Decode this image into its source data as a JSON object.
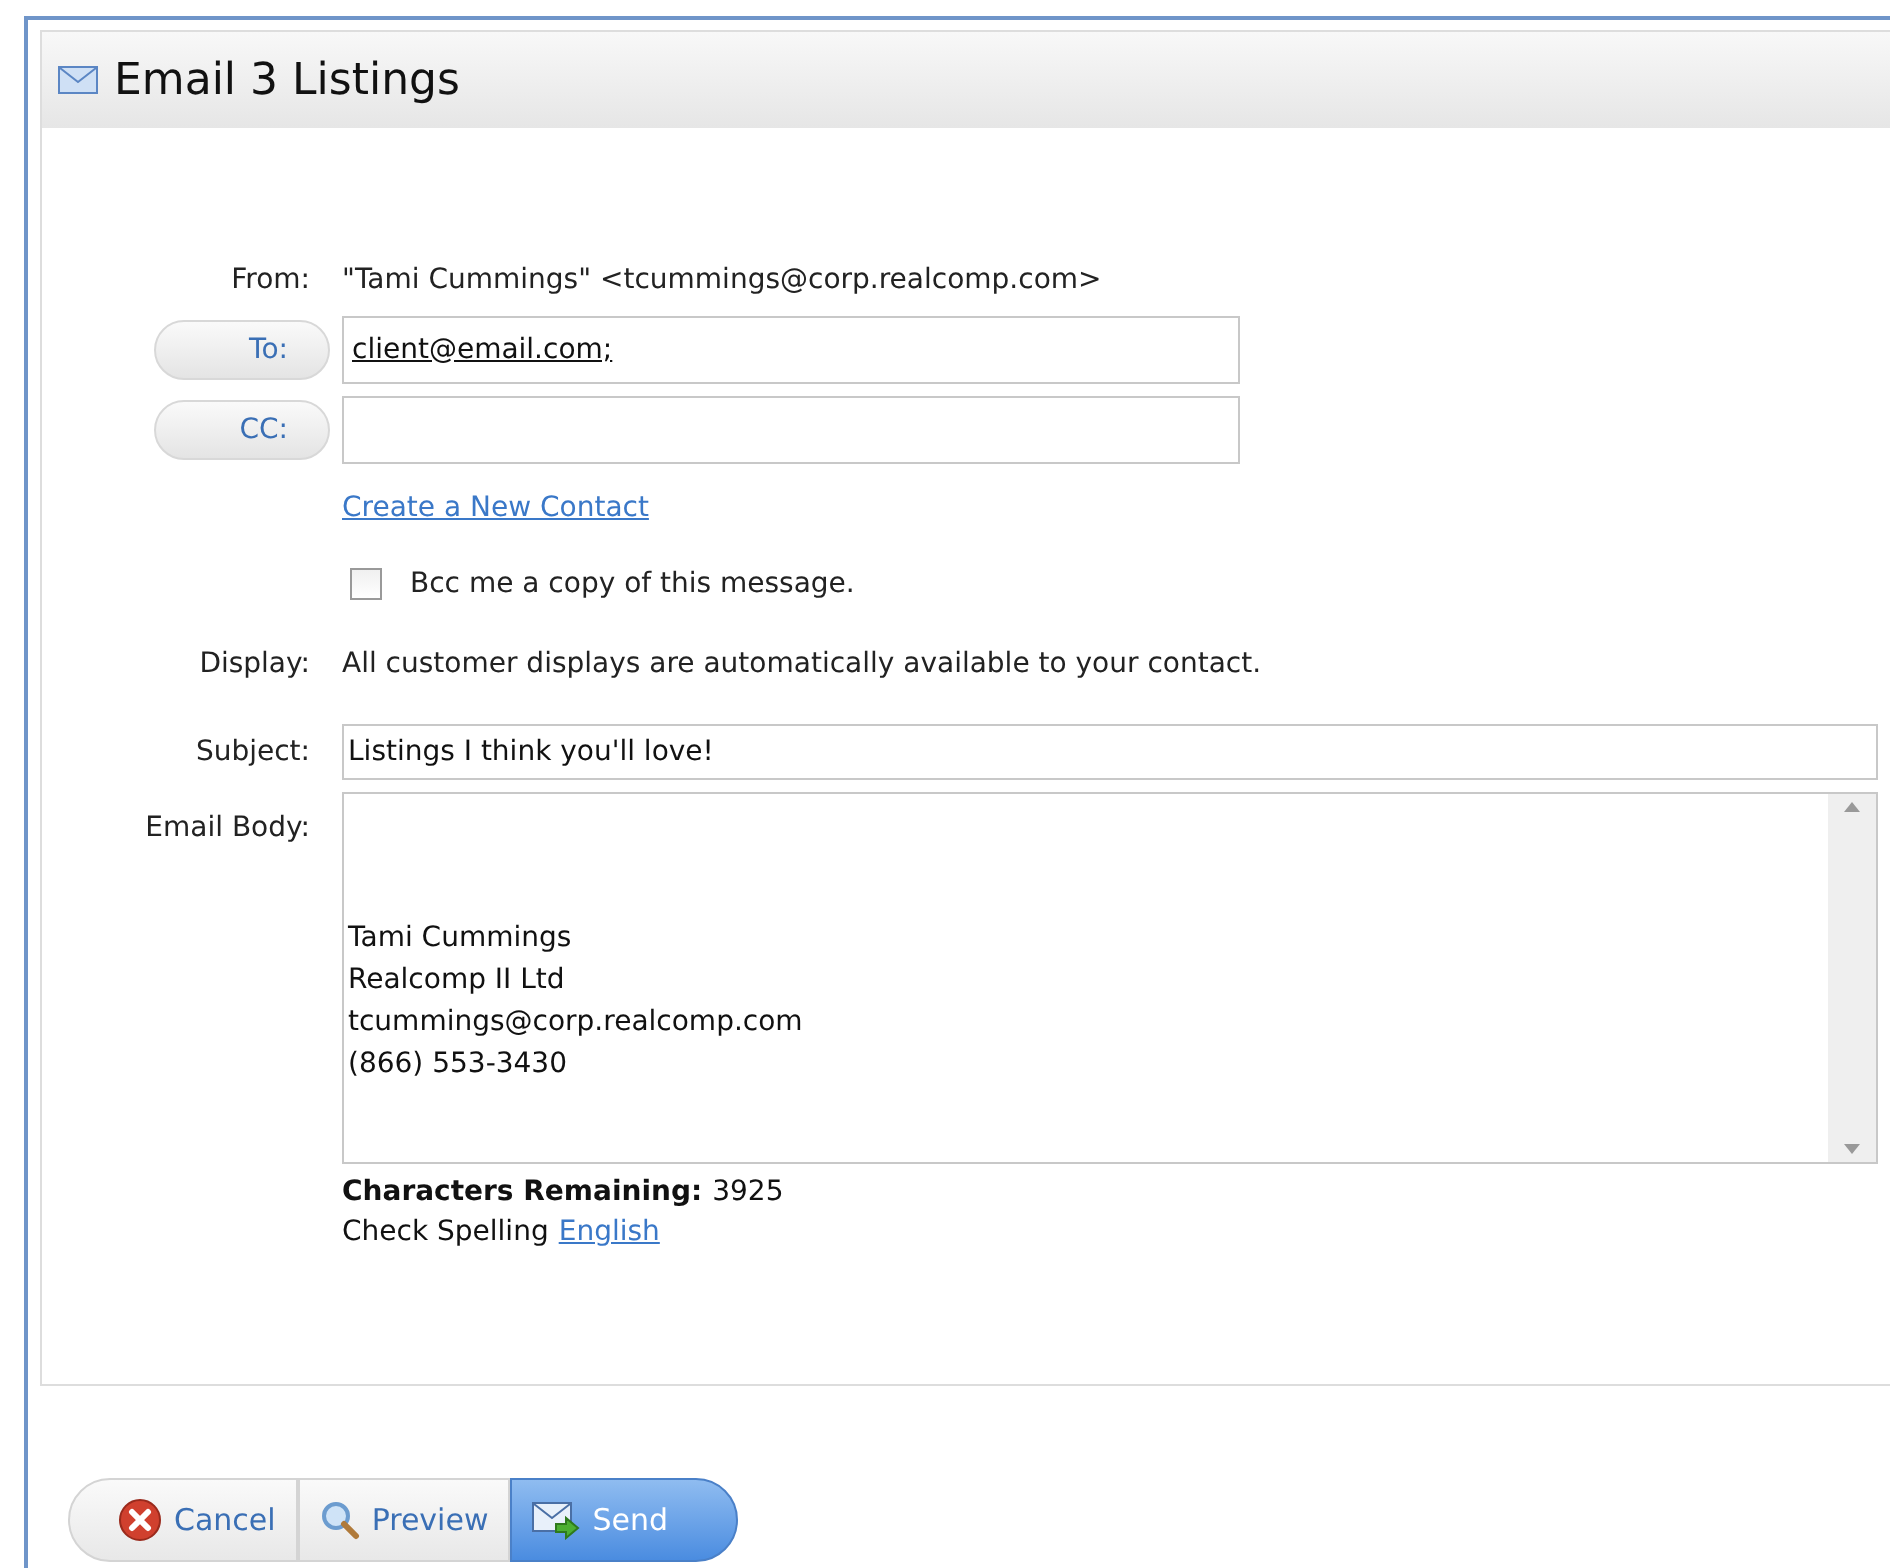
{
  "window": {
    "title": "Email 3 Listings"
  },
  "from": {
    "label": "From:",
    "value": "\"Tami Cummings\" <tcummings@corp.realcomp.com>"
  },
  "to": {
    "label": "To:",
    "value": "client@email.com;"
  },
  "cc": {
    "label": "CC:"
  },
  "create_contact_link": "Create a New Contact",
  "bcc": {
    "label": "Bcc me a copy of this message.",
    "checked": false
  },
  "display": {
    "label": "Display:",
    "value": "All customer displays are automatically available to your contact."
  },
  "subject": {
    "label": "Subject:",
    "value": "Listings I think you'll love!"
  },
  "body": {
    "label": "Email Body:",
    "lines": [
      "Tami Cummings",
      "Realcomp II Ltd",
      "tcummings@corp.realcomp.com",
      "(866) 553-3430"
    ]
  },
  "characters_remaining": {
    "label": "Characters Remaining:",
    "value": "3925"
  },
  "spelling": {
    "label": "Check Spelling",
    "link": "English"
  },
  "buttons": [
    {
      "kind": "cancel",
      "label": "Cancel",
      "selected": false
    },
    {
      "kind": "preview",
      "label": "Preview",
      "selected": false
    },
    {
      "kind": "send",
      "label": "Send",
      "selected": true
    }
  ]
}
